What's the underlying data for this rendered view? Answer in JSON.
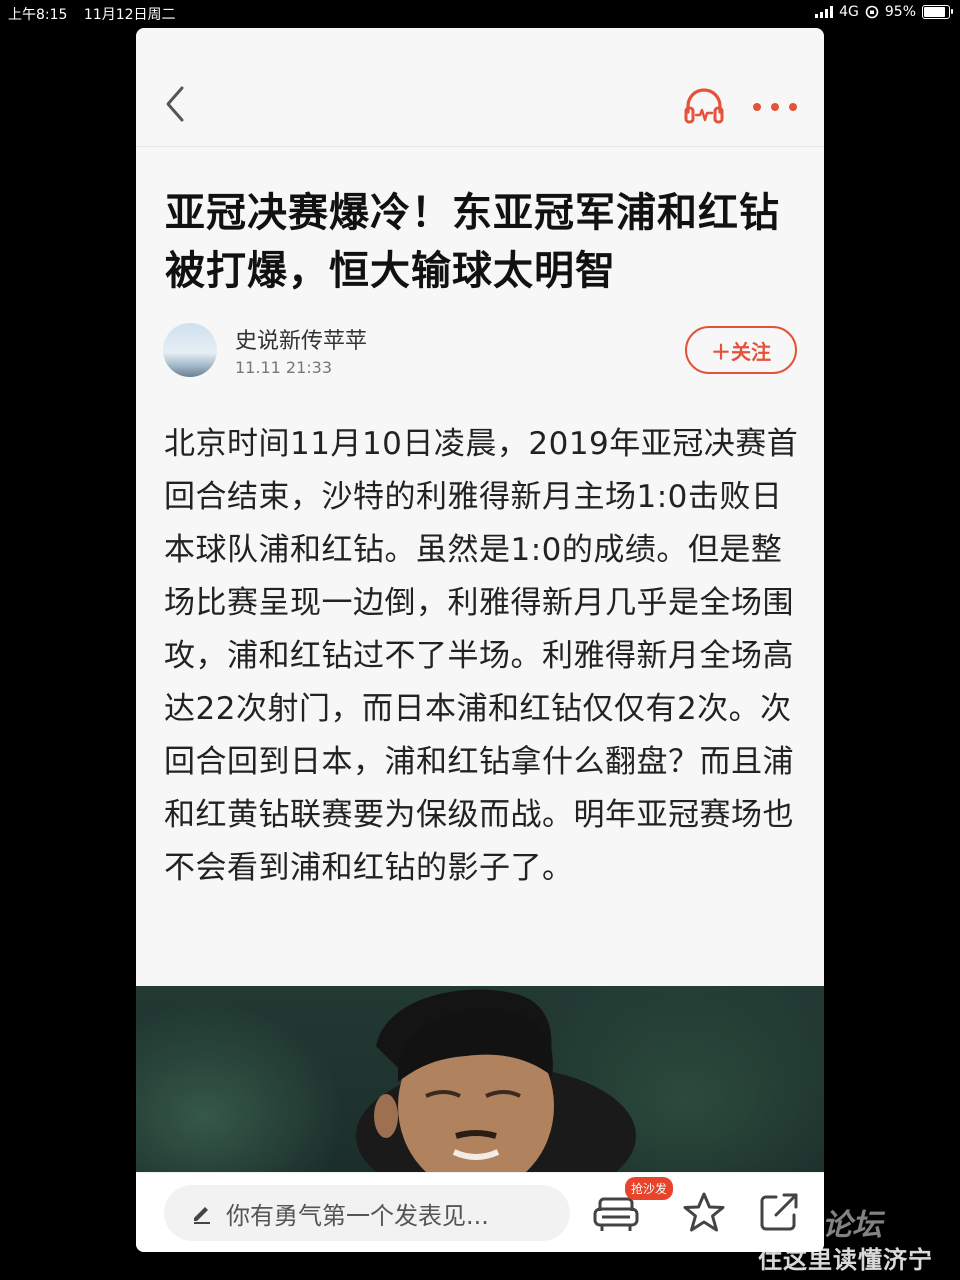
{
  "status_bar": {
    "time": "上午8:15",
    "date": "11月12日周二",
    "network": "4G",
    "battery": "95%",
    "battery_level": 0.95
  },
  "colors": {
    "accent": "#e4523a",
    "background": "#f7f7f7",
    "screen": "#000000"
  },
  "topbar": {
    "back_icon": "chevron-left-icon",
    "audio_icon": "headphones-icon",
    "more_icon": "more-dots-icon"
  },
  "article": {
    "title": "亚冠决赛爆冷！东亚冠军浦和红钻被打爆，恒大输球太明智",
    "author": "史说新传苹苹",
    "time": "11.11  21:33",
    "follow_label": "＋关注",
    "body": "北京时间11月10日凌晨，2019年亚冠决赛首回合结束，沙特的利雅得新月主场1:0击败日本球队浦和红钻。虽然是1:0的成绩。但是整场比赛呈现一边倒，利雅得新月几乎是全场围攻，浦和红钻过不了半场。利雅得新月全场高达22次射门，而日本浦和红钻仅仅有2次。次回合回到日本，浦和红钻拿什么翻盘？而且浦和红黄钻联赛要为保级而战。明年亚冠赛场也不会看到浦和红钻的影子了。"
  },
  "bottom_bar": {
    "comment_placeholder": "你有勇气第一个发表见...",
    "sofa_badge": "抢沙发",
    "sofa_icon": "sofa-icon",
    "star_icon": "star-icon",
    "share_icon": "share-icon"
  },
  "watermark": {
    "logo_text": "论坛",
    "slogan": "住这里读懂济宁"
  }
}
